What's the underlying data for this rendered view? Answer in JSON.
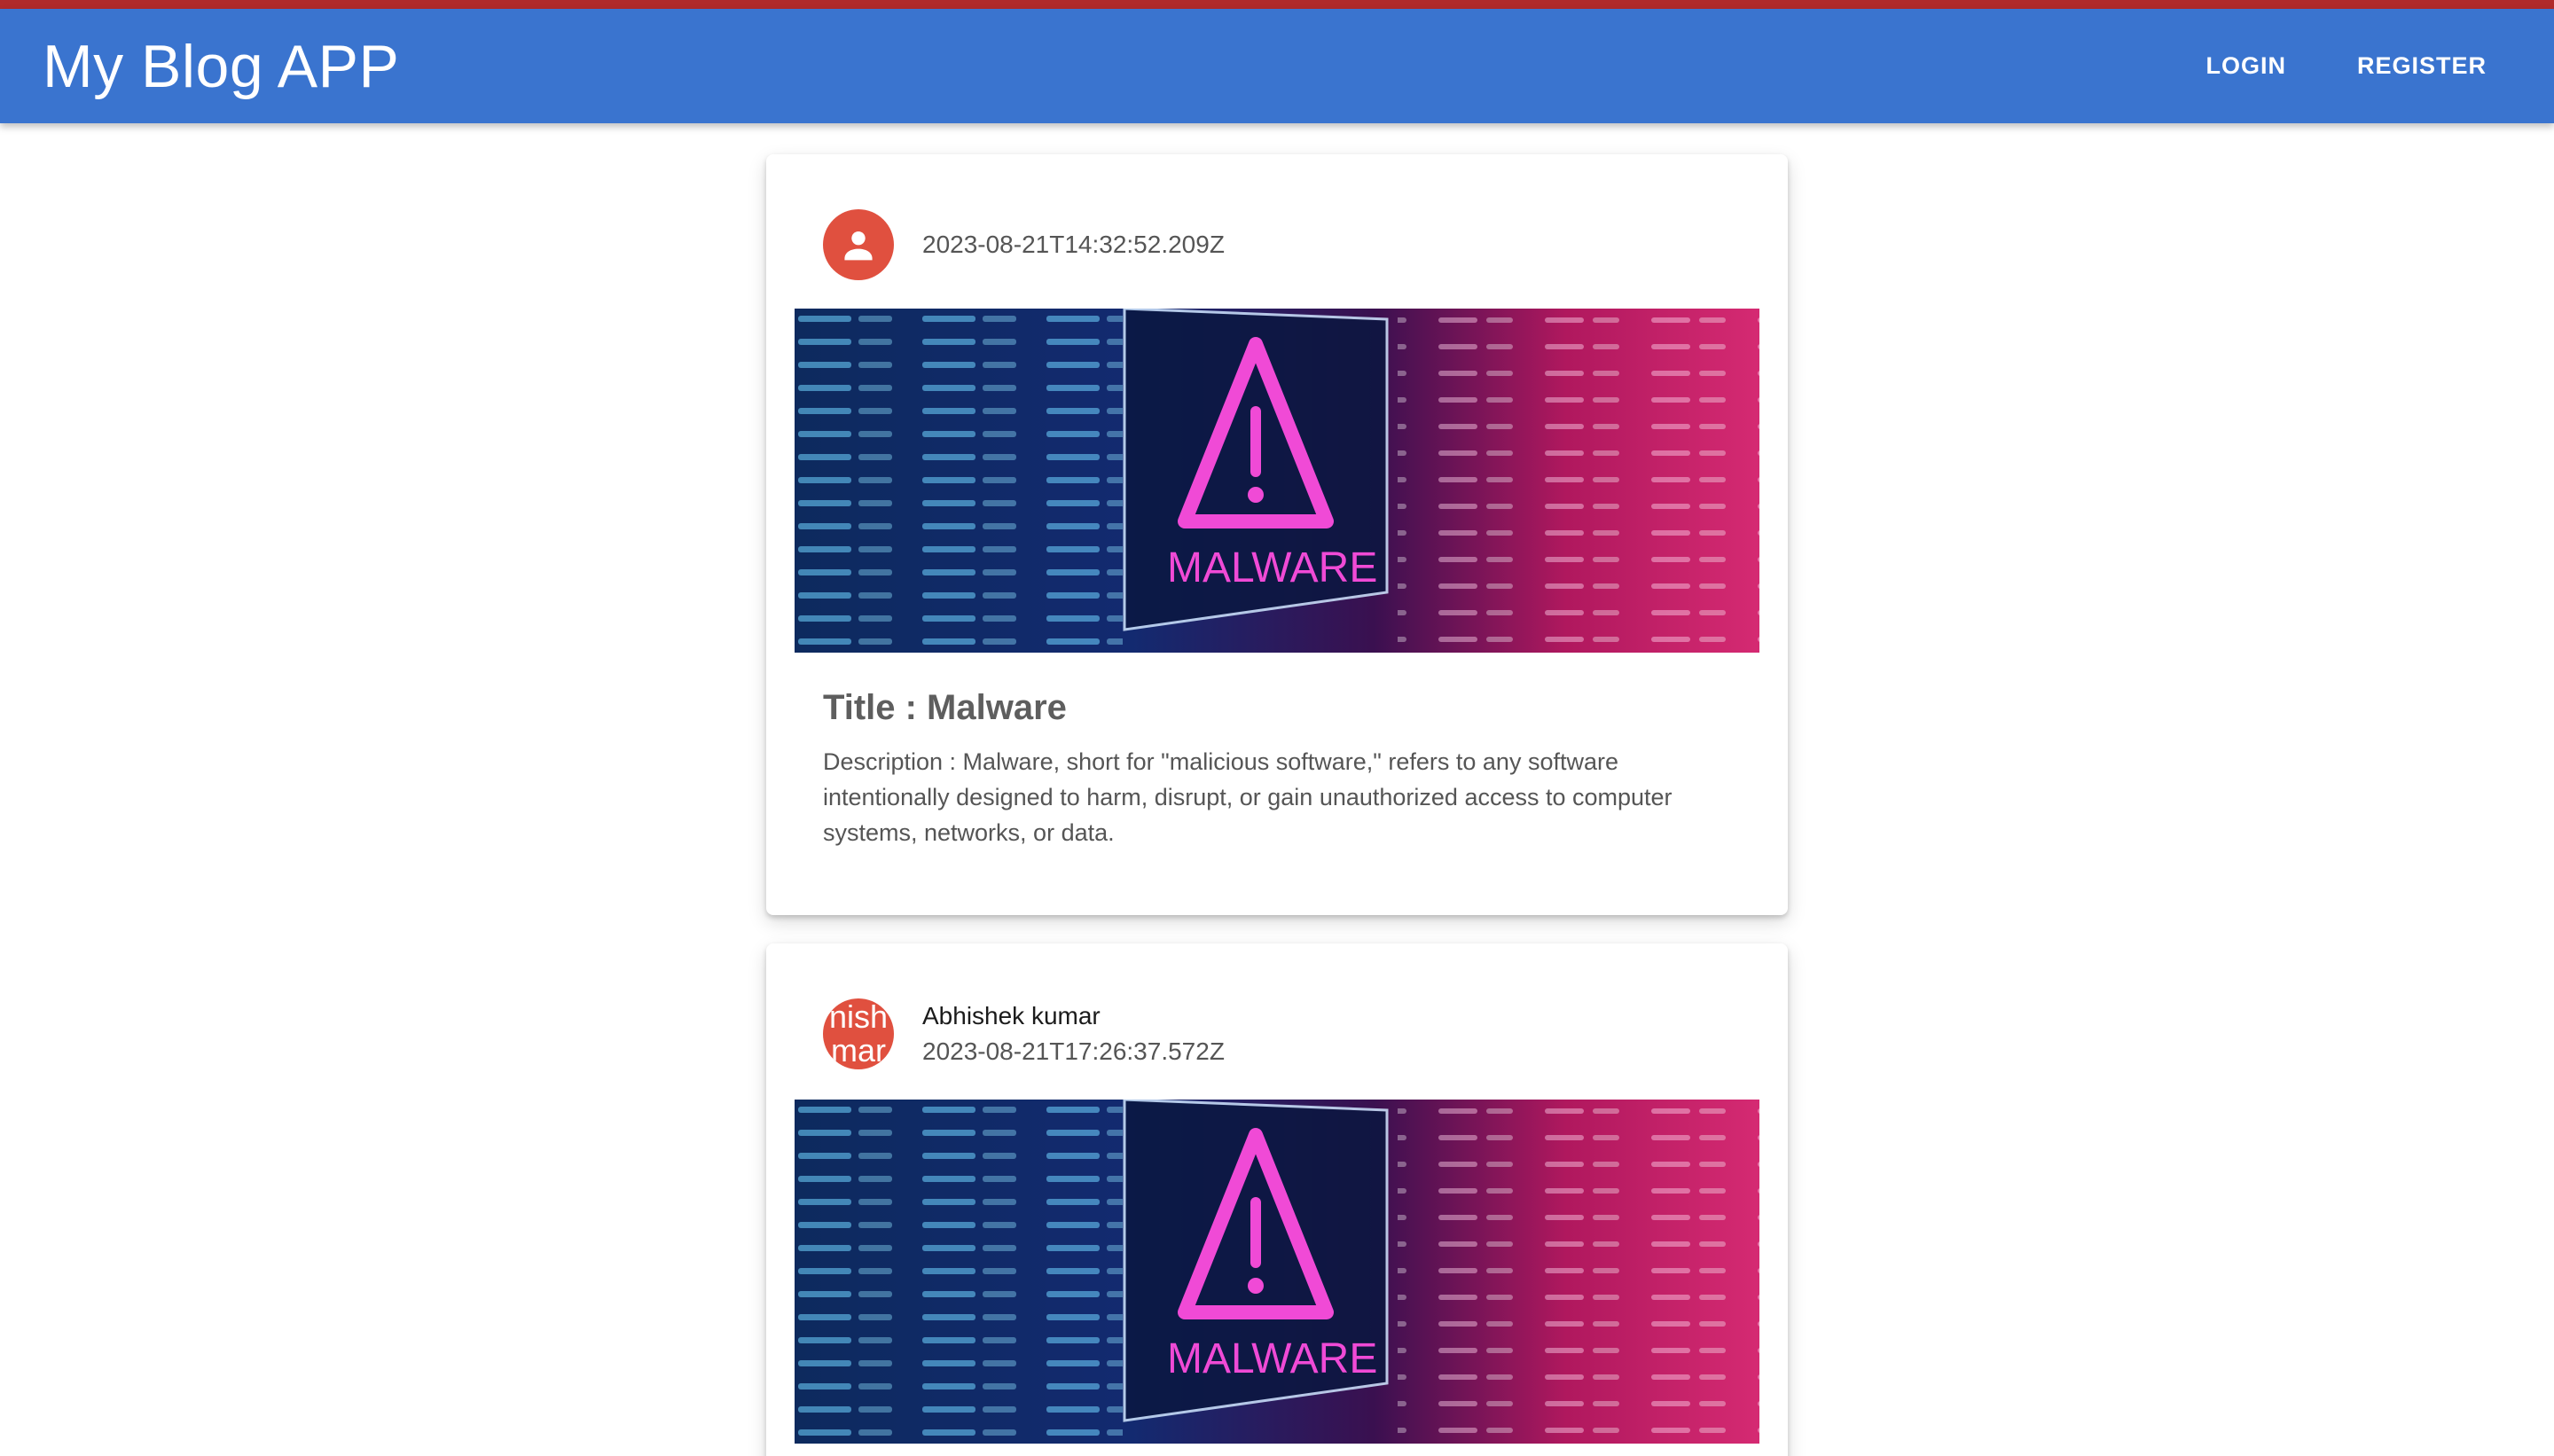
{
  "app": {
    "title": "My Blog APP",
    "accent": "#3a74cf"
  },
  "nav": {
    "login": "LOGIN",
    "register": "REGISTER"
  },
  "posts": [
    {
      "avatar_icon": "person-icon",
      "avatar_text": "",
      "author": "",
      "date": "2023-08-21T14:32:52.209Z",
      "image_caption": "MALWARE",
      "title": "Title : Malware",
      "description": "Description : Malware, short for \"malicious software,\" refers to any software intentionally designed to harm, disrupt, or gain unauthorized access to computer systems, networks, or data."
    },
    {
      "avatar_icon": "",
      "avatar_text": "nish\nmar",
      "author": "Abhishek kumar",
      "date": "2023-08-21T17:26:37.572Z",
      "image_caption": "MALWARE"
    }
  ]
}
